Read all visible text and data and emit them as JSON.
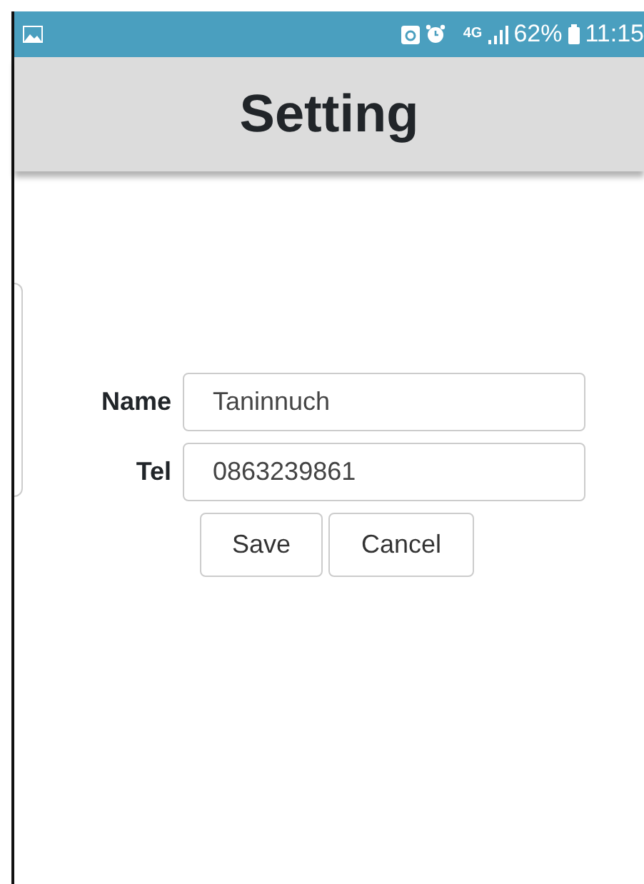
{
  "status_bar": {
    "network": "4G",
    "battery": "62%",
    "time": "11:15"
  },
  "header": {
    "title": "Setting"
  },
  "form": {
    "fields": [
      {
        "label": "Name",
        "value": "Taninnuch"
      },
      {
        "label": "Tel",
        "value": "0863239861"
      }
    ],
    "buttons": [
      "Save",
      "Cancel"
    ]
  }
}
